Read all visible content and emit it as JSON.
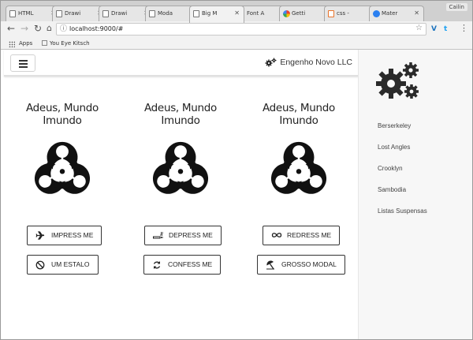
{
  "browser": {
    "tabs": [
      {
        "title": "HTML"
      },
      {
        "title": "Drawi"
      },
      {
        "title": "Drawi"
      },
      {
        "title": "Moda"
      },
      {
        "title": "Big M"
      },
      {
        "title": "Font A"
      },
      {
        "title": "Getti"
      },
      {
        "title": "css -"
      },
      {
        "title": "Mater"
      }
    ],
    "profile": "Cailin",
    "url": "localhost:9000/#",
    "bookmarks": [
      {
        "label": "Apps"
      },
      {
        "label": "You Eye Kitsch"
      }
    ],
    "extensions": [
      {
        "label": "V",
        "color": "#1d74bf"
      },
      {
        "label": "t",
        "color": "#1da1f2"
      }
    ]
  },
  "appbar": {
    "brand": "Engenho Novo LLC"
  },
  "sidebar": {
    "links": [
      "Berserkeley",
      "Lost Angles",
      "Crooklyn",
      "Sambodia",
      "Listas Suspensas"
    ]
  },
  "cards": [
    {
      "title": "Adeus, Mundo Imundo",
      "icon": "biohazard-icon"
    },
    {
      "title": "Adeus, Mundo Imundo",
      "icon": "biohazard-icon"
    },
    {
      "title": "Adeus, Mundo Imundo",
      "icon": "biohazard-icon"
    }
  ],
  "buttons": {
    "impress": "IMPRESS ME",
    "depress": "DEPRESS ME",
    "redress": "REDRESS ME",
    "estalo": "UM ESTALO",
    "confess": "CONFESS ME",
    "modal": "GROSSO MODAL"
  }
}
